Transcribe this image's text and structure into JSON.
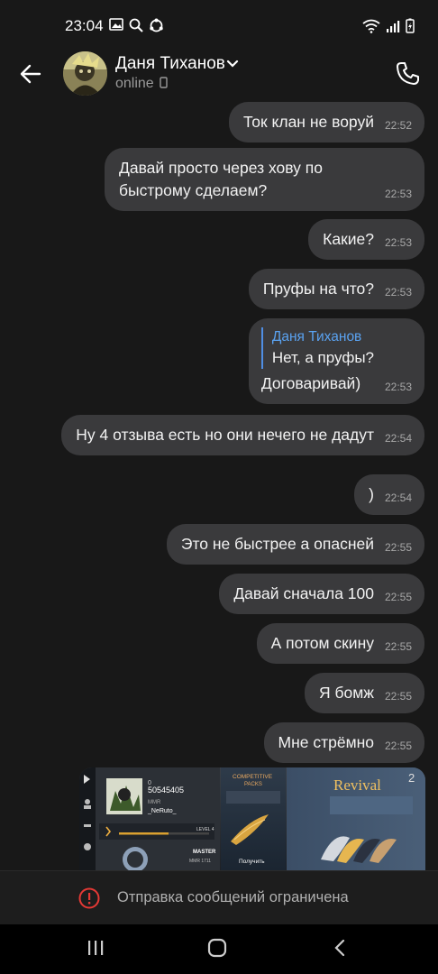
{
  "status_bar": {
    "time": "23:04"
  },
  "header": {
    "contact_name": "Даня Тиханов",
    "contact_status": "online"
  },
  "messages": [
    {
      "text": "Ток клан не воруй",
      "time": "22:52"
    },
    {
      "text": "Давай просто через хову по быстрому сделаем?",
      "time": "22:53"
    },
    {
      "text": "Какие?",
      "time": "22:53"
    },
    {
      "text": "Пруфы на что?",
      "time": "22:53"
    },
    {
      "reply_name": "Даня Тиханов",
      "reply_text": "Нет, а пруфы?",
      "text": "Договаривай)",
      "time": "22:53"
    },
    {
      "text": "Ну 4 отзыва есть но они нечего не дадут",
      "time": "22:54"
    },
    {
      "text": ")",
      "time": "22:54"
    },
    {
      "text": "Это не быстрее а опасней",
      "time": "22:55"
    },
    {
      "text": "Давай сначала 100",
      "time": "22:55"
    },
    {
      "text": "А потом скину",
      "time": "22:55"
    },
    {
      "text": "Я бомж",
      "time": "22:55"
    },
    {
      "text": "Мне стрёмно",
      "time": "22:55"
    }
  ],
  "image_message": {
    "player_id": "50545405",
    "rank_label": "MMR",
    "nickname": "_NeRuto_",
    "level_label": "LEVEL 4",
    "rank_name": "MASTER",
    "mmr_line": "MMR 1711",
    "panel_title": "COMPETITIVE",
    "panel_subtitle": "PACKS",
    "panel_button": "Получить",
    "revival_title": "Revival",
    "revival_counter": "2"
  },
  "restriction": {
    "text": "Отправка сообщений ограничена"
  },
  "colors": {
    "bubble": "#3a3a3c",
    "background": "#181818",
    "reply_accent": "#5aa2f0",
    "error": "#e53935"
  }
}
